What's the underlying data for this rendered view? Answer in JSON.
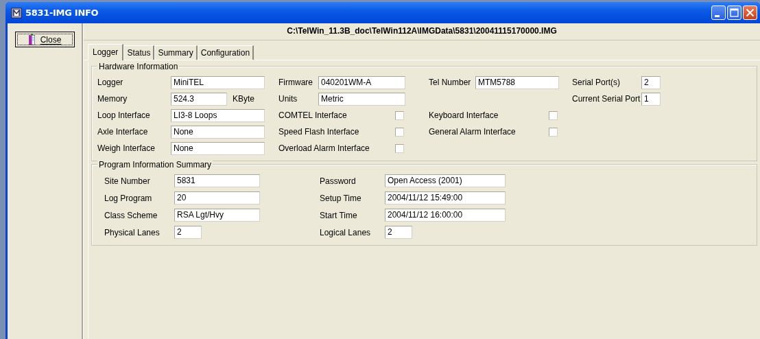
{
  "window": {
    "title": "5831-IMG INFO"
  },
  "close_button": {
    "label": "Close"
  },
  "file_path": "C:\\TelWin_11.3B_doc\\TelWin112A\\IMGData\\5831\\20041115170000.IMG",
  "tabs": [
    {
      "label": "Logger",
      "selected": true
    },
    {
      "label": "Status",
      "selected": false
    },
    {
      "label": "Summary",
      "selected": false
    },
    {
      "label": "Configuration",
      "selected": false
    }
  ],
  "hardware": {
    "title": "Hardware Information",
    "columns": [
      [
        {
          "kind": "field",
          "label": "Logger",
          "value": "MiniTEL"
        },
        {
          "kind": "field_unit",
          "label": "Memory",
          "value": "524.3",
          "unit": "KByte"
        },
        {
          "kind": "field",
          "label": "Loop Interface",
          "value": "LI3-8 Loops"
        },
        {
          "kind": "field",
          "label": "Axle Interface",
          "value": "None"
        },
        {
          "kind": "field",
          "label": "Weigh Interface",
          "value": "None"
        }
      ],
      [
        {
          "kind": "field",
          "label": "Firmware",
          "value": "040201WM-A"
        },
        {
          "kind": "field",
          "label": "Units",
          "value": "Metric"
        },
        {
          "kind": "checkbox",
          "label": "COMTEL Interface",
          "checked": false
        },
        {
          "kind": "checkbox",
          "label": "Speed Flash Interface",
          "checked": false
        },
        {
          "kind": "checkbox",
          "label": "Overload Alarm Interface",
          "checked": false
        }
      ],
      [
        {
          "kind": "field",
          "label": "Tel Number",
          "value": "MTM5788"
        },
        {
          "kind": "checkbox",
          "label": "Keyboard Interface",
          "checked": false
        },
        {
          "kind": "checkbox",
          "label": "General Alarm Interface",
          "checked": false
        }
      ],
      [
        {
          "kind": "field",
          "label": "Serial Port(s)",
          "value": "2"
        },
        {
          "kind": "field",
          "label": "Current Serial Port",
          "value": "1"
        }
      ]
    ]
  },
  "program": {
    "title": "Program Information Summary",
    "columns": [
      [
        {
          "kind": "field",
          "label": "Site Number",
          "value": "5831"
        },
        {
          "kind": "field",
          "label": "Log Program",
          "value": "20"
        },
        {
          "kind": "field",
          "label": "Class Scheme",
          "value": "RSA Lgt/Hvy"
        },
        {
          "kind": "short_field",
          "label": "Physical Lanes",
          "value": "2"
        }
      ],
      [
        {
          "kind": "field",
          "label": "Password",
          "value": "Open Access (2001)"
        },
        {
          "kind": "field",
          "label": "Setup Time",
          "value": "2004/11/12  15:49:00"
        },
        {
          "kind": "field",
          "label": "Start Time",
          "value": "2004/11/12  16:00:00"
        },
        {
          "kind": "short_field",
          "label": "Logical Lanes",
          "value": "2"
        }
      ]
    ]
  }
}
